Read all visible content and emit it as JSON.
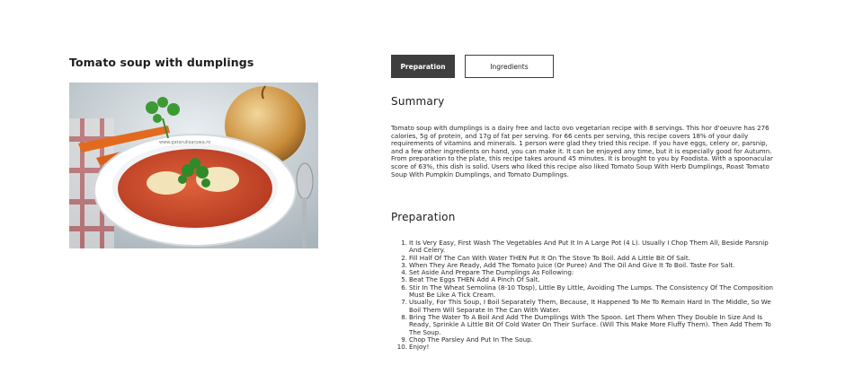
{
  "recipe": {
    "title": "Tomato soup with dumplings",
    "image_watermark": "www.gatarulisaruwa.ro"
  },
  "tabs": [
    {
      "label": "Preparation",
      "active": true
    },
    {
      "label": "Ingredients",
      "active": false
    }
  ],
  "summary": {
    "heading": "Summary",
    "text": "Tomato soup with dumplings is a dairy free and lacto ovo vegetarian recipe with 8 servings. This hor d'oeuvre has 276 calories, 5g of protein, and 17g of fat per serving. For 66 cents per serving, this recipe covers 18% of your daily requirements of vitamins and minerals. 1 person were glad they tried this recipe. If you have eggs, celery or, parsnip, and a few other ingredients on hand, you can make it. It can be enjoyed any time, but it is especially good for Autumn. From preparation to the plate, this recipe takes around 45 minutes. It is brought to you by Foodista. With a spoonacular score of 63%, this dish is solid. Users who liked this recipe also liked Tomato Soup With Herb Dumplings, Roast Tomato Soup With Pumpkin Dumplings, and Tomato Dumplings."
  },
  "preparation": {
    "heading": "Preparation",
    "steps": [
      {
        "num": "1.",
        "text": "It Is Very Easy, First Wash The Vegetables And Put It In A Large Pot (4 L). Usually I Chop Them All, Beside Parsnip And Celery."
      },
      {
        "num": "2.",
        "text": "Fill Half Of The Can With Water THEN Put It On The Stove To Boil. Add A Little Bit Of Salt."
      },
      {
        "num": "3.",
        "text": "When They Are Ready, Add The Tomato Juice (Or Puree) And The Oil And Give It To Boil. Taste For Salt."
      },
      {
        "num": "4.",
        "text": "Set Aside And Prepare The Dumplings As Following:"
      },
      {
        "num": "5.",
        "text": "Beat The Eggs THEN Add A Pinch Of Salt."
      },
      {
        "num": "6.",
        "text": "Stir In The Wheat Semolina (8-10 Tbsp), Little By Little, Avoiding The Lumps. The Consistency Of The Composition Must Be Like A Tick Cream."
      },
      {
        "num": "7.",
        "text": "Usually, For This Soup, I Boil Separately Them, Because, It Happened To Me To Remain Hard In The Middle, So We Boil Them Will Separate In The Can With Water."
      },
      {
        "num": "8.",
        "text": "Bring The Water To A Boil And Add The Dumplings With The Spoon. Let Them When They Double In Size And Is Ready, Sprinkle A Little Bit Of Cold Water On Their Surface. (Will This Make More Fluffy Them). Then Add Them To The Soup."
      },
      {
        "num": "9.",
        "text": "Chop The Parsley And Put In The Soup."
      },
      {
        "num": "10.",
        "text": "Enjoy!"
      }
    ]
  },
  "colors": {
    "tab_active_bg": "#3e3e3e",
    "soup": "#c9472a",
    "text": "#2a2a2a"
  }
}
